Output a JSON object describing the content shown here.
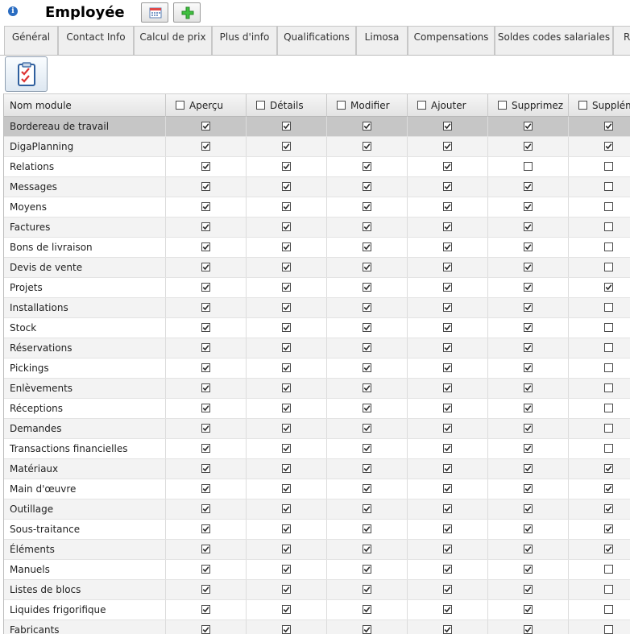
{
  "header": {
    "title": "Employée",
    "info_icon": "info-icon",
    "buttons": [
      "calendar-icon",
      "add-icon"
    ]
  },
  "tabs": [
    "Général",
    "Contact Info",
    "Calcul de prix",
    "Plus d'info",
    "Qualifications",
    "Limosa",
    "Compensations",
    "Soldes codes salariales",
    "R"
  ],
  "toolbar": {
    "button_icon": "checklist-icon"
  },
  "grid": {
    "columns": [
      "Nom module",
      "Aperçu",
      "Détails",
      "Modifier",
      "Ajouter",
      "Supprimez",
      "Supplém"
    ],
    "selected_row": 0,
    "rows": [
      {
        "name": "Bordereau de travail",
        "perms": [
          true,
          true,
          true,
          true,
          true,
          true
        ]
      },
      {
        "name": "DigaPlanning",
        "perms": [
          true,
          true,
          true,
          true,
          true,
          true
        ]
      },
      {
        "name": "Relations",
        "perms": [
          true,
          true,
          true,
          true,
          false,
          false
        ]
      },
      {
        "name": "Messages",
        "perms": [
          true,
          true,
          true,
          true,
          true,
          false
        ]
      },
      {
        "name": "Moyens",
        "perms": [
          true,
          true,
          true,
          true,
          true,
          false
        ]
      },
      {
        "name": "Factures",
        "perms": [
          true,
          true,
          true,
          true,
          true,
          false
        ]
      },
      {
        "name": "Bons de livraison",
        "perms": [
          true,
          true,
          true,
          true,
          true,
          false
        ]
      },
      {
        "name": "Devis de vente",
        "perms": [
          true,
          true,
          true,
          true,
          true,
          false
        ]
      },
      {
        "name": "Projets",
        "perms": [
          true,
          true,
          true,
          true,
          true,
          true
        ]
      },
      {
        "name": "Installations",
        "perms": [
          true,
          true,
          true,
          true,
          true,
          false
        ]
      },
      {
        "name": "Stock",
        "perms": [
          true,
          true,
          true,
          true,
          true,
          false
        ]
      },
      {
        "name": "Réservations",
        "perms": [
          true,
          true,
          true,
          true,
          true,
          false
        ]
      },
      {
        "name": "Pickings",
        "perms": [
          true,
          true,
          true,
          true,
          true,
          false
        ]
      },
      {
        "name": "Enlèvements",
        "perms": [
          true,
          true,
          true,
          true,
          true,
          false
        ]
      },
      {
        "name": "Réceptions",
        "perms": [
          true,
          true,
          true,
          true,
          true,
          false
        ]
      },
      {
        "name": "Demandes",
        "perms": [
          true,
          true,
          true,
          true,
          true,
          false
        ]
      },
      {
        "name": "Transactions financielles",
        "perms": [
          true,
          true,
          true,
          true,
          true,
          false
        ]
      },
      {
        "name": "Matériaux",
        "perms": [
          true,
          true,
          true,
          true,
          true,
          true
        ]
      },
      {
        "name": "Main d'œuvre",
        "perms": [
          true,
          true,
          true,
          true,
          true,
          true
        ]
      },
      {
        "name": "Outillage",
        "perms": [
          true,
          true,
          true,
          true,
          true,
          true
        ]
      },
      {
        "name": "Sous-traitance",
        "perms": [
          true,
          true,
          true,
          true,
          true,
          true
        ]
      },
      {
        "name": "Éléments",
        "perms": [
          true,
          true,
          true,
          true,
          true,
          true
        ]
      },
      {
        "name": "Manuels",
        "perms": [
          true,
          true,
          true,
          true,
          true,
          false
        ]
      },
      {
        "name": "Listes de blocs",
        "perms": [
          true,
          true,
          true,
          true,
          true,
          false
        ]
      },
      {
        "name": "Liquides frigorifique",
        "perms": [
          true,
          true,
          true,
          true,
          true,
          false
        ]
      },
      {
        "name": "Fabricants",
        "perms": [
          true,
          true,
          true,
          true,
          true,
          false
        ]
      }
    ]
  }
}
